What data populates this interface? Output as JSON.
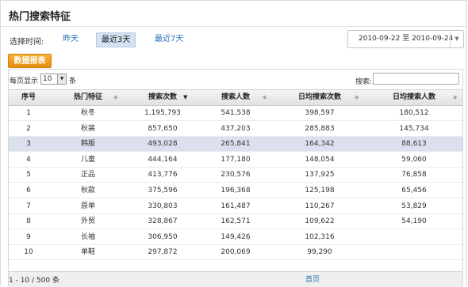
{
  "panel": {
    "title": "热门搜索特征"
  },
  "time_filter": {
    "label": "选择时间:",
    "options": [
      {
        "label": "昨天",
        "active": false
      },
      {
        "label": "最近3天",
        "active": true
      },
      {
        "label": "最近7天",
        "active": false
      }
    ],
    "date_from": "2010-09-22",
    "date_sep": "至",
    "date_to": "2010-09-24"
  },
  "report_button": "数据报表",
  "table_controls": {
    "per_page_prefix": "每页显示",
    "per_page_value": "10",
    "per_page_suffix": "条",
    "search_label": "搜索:",
    "search_value": ""
  },
  "columns": [
    {
      "label": "序号",
      "sortable": false
    },
    {
      "label": "热门特征",
      "sortable": true
    },
    {
      "label": "搜索次数",
      "sortable": true,
      "sorted_desc": true
    },
    {
      "label": "搜索人数",
      "sortable": true
    },
    {
      "label": "日均搜索次数",
      "sortable": true
    },
    {
      "label": "日均搜索人数",
      "sortable": true
    }
  ],
  "rows": [
    [
      "1",
      "秋冬",
      "1,195,793",
      "541,538",
      "398,597",
      "180,512"
    ],
    [
      "2",
      "秋装",
      "857,650",
      "437,203",
      "285,883",
      "145,734"
    ],
    [
      "3",
      "韩版",
      "493,028",
      "265,841",
      "164,342",
      "88,613"
    ],
    [
      "4",
      "儿童",
      "444,164",
      "177,180",
      "148,054",
      "59,060"
    ],
    [
      "5",
      "正品",
      "413,776",
      "230,576",
      "137,925",
      "76,858"
    ],
    [
      "6",
      "秋款",
      "375,596",
      "196,368",
      "125,198",
      "65,456"
    ],
    [
      "7",
      "原单",
      "330,803",
      "161,487",
      "110,267",
      "53,829"
    ],
    [
      "8",
      "外贸",
      "328,867",
      "162,571",
      "109,622",
      "54,190"
    ],
    [
      "9",
      "长袖",
      "306,950",
      "149,426",
      "102,316",
      ""
    ],
    [
      "10",
      "单鞋",
      "297,872",
      "200,069",
      "99,290",
      ""
    ]
  ],
  "highlighted_row": 2,
  "footer": {
    "info": "1 - 10 / 500 条",
    "first_label": "首页"
  },
  "colors": {
    "accent": "#2a6fb4",
    "button": "#f0a020",
    "highlight_row": "#dbe0ef"
  }
}
